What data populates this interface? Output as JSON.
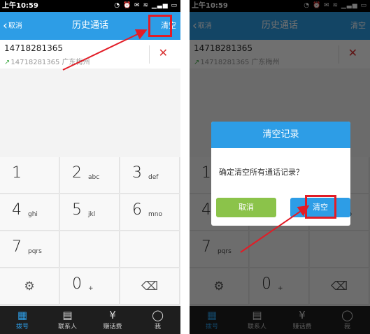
{
  "status": {
    "time": "上午10:59",
    "icons": "◔ ⏰ ✉ ≋ ▁▃▅ ▭"
  },
  "header": {
    "back_label": "取消",
    "title": "历史通话",
    "clear_label": "清空"
  },
  "call": {
    "number": "14718281365",
    "detail": "14718281365 广东梅州",
    "delete_icon": "✕"
  },
  "keypad": {
    "keys": [
      {
        "digit": "1",
        "letters": ""
      },
      {
        "digit": "2",
        "letters": "abc"
      },
      {
        "digit": "3",
        "letters": "def"
      },
      {
        "digit": "4",
        "letters": "ghi"
      },
      {
        "digit": "5",
        "letters": "jkl"
      },
      {
        "digit": "6",
        "letters": "mno"
      },
      {
        "digit": "7",
        "letters": "pqrs"
      },
      {
        "digit": "",
        "letters": ""
      },
      {
        "digit": "",
        "letters": ""
      },
      {
        "digit": "⚙",
        "letters": ""
      },
      {
        "digit": "0",
        "letters": "+"
      },
      {
        "digit": "⌫",
        "letters": ""
      }
    ]
  },
  "tabs": [
    {
      "label": "拨号",
      "icon": "▦"
    },
    {
      "label": "联系人",
      "icon": "▤"
    },
    {
      "label": "赚话费",
      "icon": "¥"
    },
    {
      "label": "我",
      "icon": "◯"
    }
  ],
  "dialog": {
    "title": "清空记录",
    "message": "确定清空所有通话记录？",
    "cancel_label": "取消",
    "confirm_label": "清空"
  },
  "colors": {
    "accent": "#2d9de6",
    "cancel": "#8bc34a",
    "highlight": "#e21c26"
  }
}
